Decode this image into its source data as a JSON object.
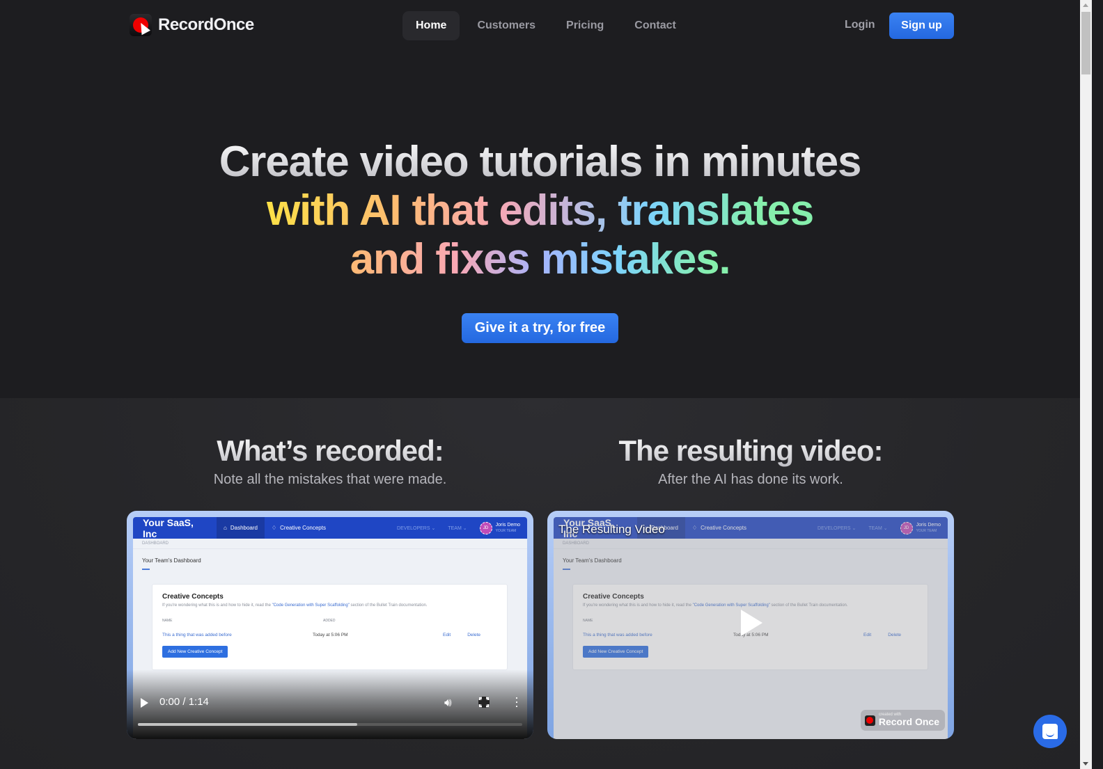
{
  "nav": {
    "brand": "RecordOnce",
    "links": [
      {
        "label": "Home",
        "active": true
      },
      {
        "label": "Customers",
        "active": false
      },
      {
        "label": "Pricing",
        "active": false
      },
      {
        "label": "Contact",
        "active": false
      }
    ],
    "login": "Login",
    "signup": "Sign up"
  },
  "hero": {
    "line1": "Create video tutorials in minutes",
    "line2": "with AI that edits, translates",
    "line3": "and fixes mistakes.",
    "cta": "Give it a try, for free"
  },
  "compare": {
    "left": {
      "title": "What’s recorded:",
      "subtitle": "Note all the mistakes that were made.",
      "player": {
        "time": "0:00 / 1:14",
        "progress_buffered": 0.57
      }
    },
    "right": {
      "title": "The resulting video:",
      "subtitle": "After the AI has done its work.",
      "overlay_title": "The Resulting Video",
      "badge_small": "created with",
      "badge_name": "Record Once"
    }
  },
  "demo_app": {
    "brand": "Your SaaS, Inc",
    "tabs": [
      "Dashboard",
      "Creative Concepts"
    ],
    "menu": [
      "DEVELOPERS ⌄",
      "TEAM ⌄"
    ],
    "avatar_initials": "JD",
    "user_name": "Joris Demo",
    "user_team": "YOUR TEAM",
    "breadcrumb": "DASHBOARD",
    "page_title": "Your Team's Dashboard",
    "card_title": "Creative Concepts",
    "card_desc_before": "If you're wondering what this is and how to hide it, read the ",
    "card_desc_link": "\"Code Generation with Super Scaffolding\"",
    "card_desc_after": " section of the Bullet Train documentation.",
    "col_name": "NAME",
    "col_added": "ADDED",
    "row_name": "This a thing that was added before",
    "row_added": "Today at 5:06 PM",
    "row_edit": "Edit",
    "row_delete": "Delete",
    "add_button": "Add New Creative Concept"
  },
  "colors": {
    "accent": "#2a6be6",
    "background": "#1d1d20"
  }
}
